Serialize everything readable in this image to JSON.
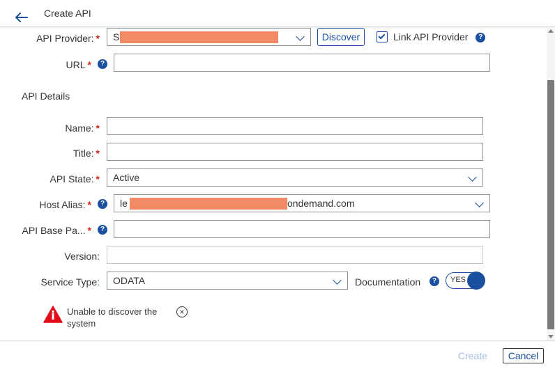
{
  "header": {
    "title": "Create API"
  },
  "form": {
    "api_provider": {
      "label": "API Provider:",
      "value": "S",
      "required": "*"
    },
    "discover_label": "Discover",
    "link_provider": {
      "label": "Link API Provider",
      "checked": true
    },
    "url": {
      "label": "URL",
      "value": "",
      "required": "*"
    },
    "section_title": "API Details",
    "name": {
      "label": "Name:",
      "value": "",
      "required": "*"
    },
    "title": {
      "label": "Title:",
      "value": "",
      "required": "*"
    },
    "api_state": {
      "label": "API State:",
      "value": "Active",
      "required": "*"
    },
    "host_alias": {
      "label": "Host Alias:",
      "value_prefix": "le",
      "value_suffix": "ondemand.com",
      "required": "*"
    },
    "api_base_path": {
      "label": "API Base Pa...",
      "value": "",
      "required": "*"
    },
    "version": {
      "label": "Version:",
      "value": ""
    },
    "service_type": {
      "label": "Service Type:",
      "value": "ODATA"
    },
    "documentation": {
      "label": "Documentation",
      "toggle": "YES"
    }
  },
  "warning": {
    "text": "Unable to discover the system"
  },
  "footer": {
    "create_label": "Create",
    "cancel_label": "Cancel"
  },
  "icons": {
    "help": "?",
    "close": "×"
  },
  "colors": {
    "accent": "#1b4fa0",
    "required": "#d0271d",
    "error": "#e00d19",
    "redaction": "#f38a66"
  }
}
